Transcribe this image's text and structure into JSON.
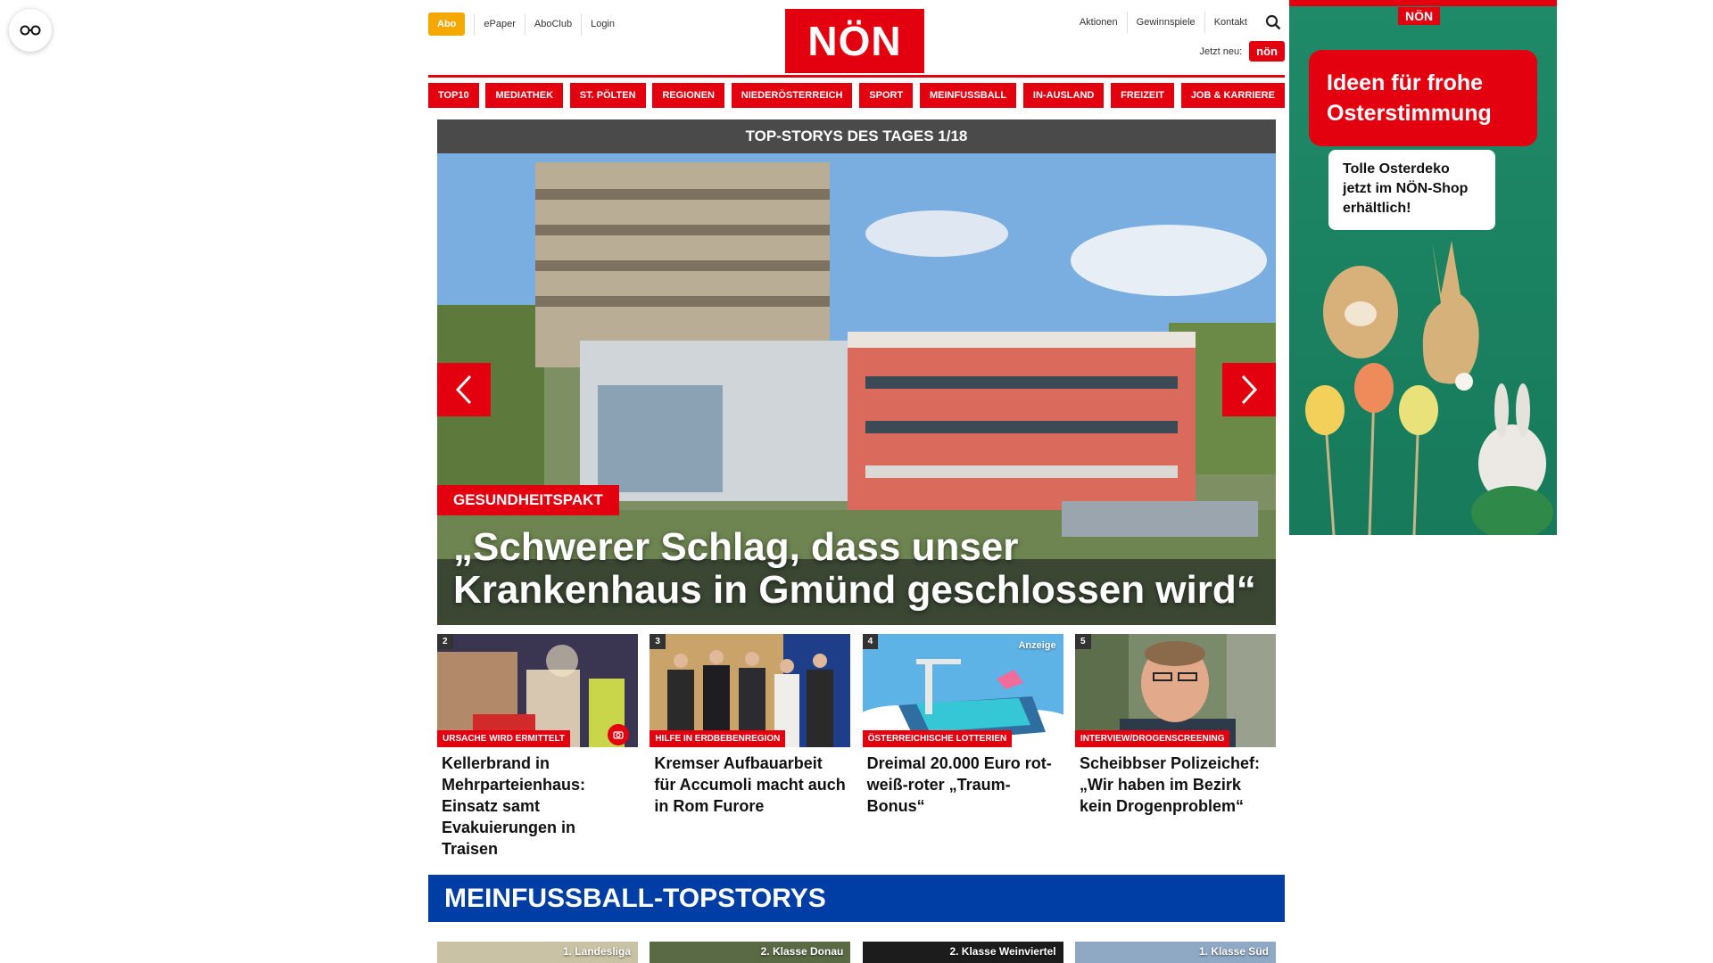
{
  "header": {
    "abo": "Abo",
    "left_links": [
      "ePaper",
      "AboClub",
      "Login"
    ],
    "logo": "NÖN",
    "right_links": [
      "Aktionen",
      "Gewinnspiele",
      "Kontakt"
    ],
    "jetzt_label": "Jetzt neu:",
    "jetzt_badge": "nön"
  },
  "nav": [
    "TOP10",
    "MEDIATHEK",
    "ST. PÖLTEN",
    "REGIONEN",
    "NIEDERÖSTERREICH",
    "SPORT",
    "MEINFUSSBALL",
    "IN-AUSLAND",
    "FREIZEIT",
    "JOB & KARRIERE"
  ],
  "carousel": {
    "header": "TOP-STORYS DES TAGES 1/18",
    "category": "GESUNDHEITSPAKT",
    "title": "„Schwerer Schlag, dass unser Krankenhaus in Gmünd geschlossen wird“"
  },
  "cards": [
    {
      "num": "2",
      "category": "Ursache wird ermittelt",
      "title": "Kellerbrand in Mehrparteienhaus: Einsatz samt Evakuierungen in Traisen",
      "ad": ""
    },
    {
      "num": "3",
      "category": "Hilfe in Erdbebenregion",
      "title": "Kremser Aufbauarbeit für Accumoli macht auch in Rom Furore",
      "ad": ""
    },
    {
      "num": "4",
      "category": "Österreichische Lotterien",
      "title": "Dreimal 20.000 Euro rot-weiß-roter „Traum-Bonus“",
      "ad": "Anzeige"
    },
    {
      "num": "5",
      "category": "Interview/Drogenscreening",
      "title": "Scheibbser Polizeichef: „Wir haben im Bezirk kein Drogenproblem“",
      "ad": ""
    }
  ],
  "meinfussball": {
    "title": "MEINFUSSBALL-TOPSTORYS",
    "labels": [
      "1. Landesliga",
      "2. Klasse Donau",
      "2. Klasse Weinviertel",
      "1. Klasse Süd"
    ]
  },
  "ad": {
    "logo": "NÖN",
    "headline": "Ideen für frohe Osterstimmung",
    "text": "Tolle Osterdeko jetzt im NÖN-Shop erhältlich!"
  },
  "colors": {
    "brand_red": "#e3000f",
    "abo_orange": "#f5a800",
    "fussball_blue": "#003da5",
    "ad_green": "#1f8a68"
  }
}
